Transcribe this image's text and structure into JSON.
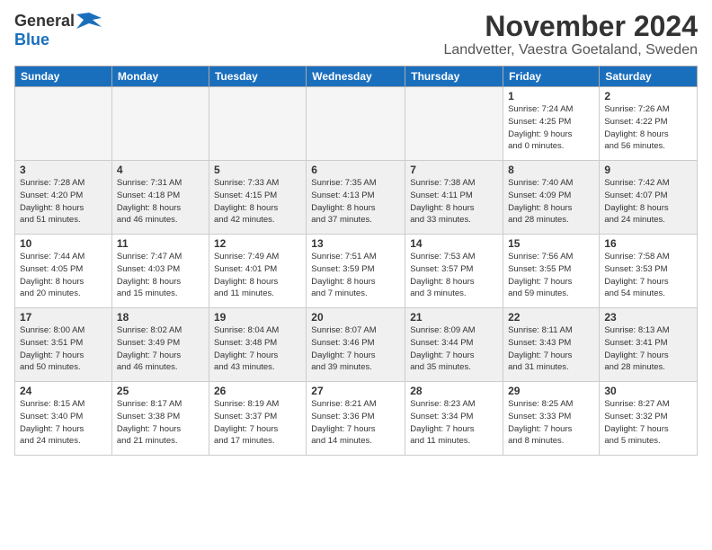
{
  "logo": {
    "general": "General",
    "blue": "Blue"
  },
  "title": "November 2024",
  "location": "Landvetter, Vaestra Goetaland, Sweden",
  "days_of_week": [
    "Sunday",
    "Monday",
    "Tuesday",
    "Wednesday",
    "Thursday",
    "Friday",
    "Saturday"
  ],
  "weeks": [
    {
      "shaded": false,
      "days": [
        {
          "num": "",
          "info": "",
          "empty": true
        },
        {
          "num": "",
          "info": "",
          "empty": true
        },
        {
          "num": "",
          "info": "",
          "empty": true
        },
        {
          "num": "",
          "info": "",
          "empty": true
        },
        {
          "num": "",
          "info": "",
          "empty": true
        },
        {
          "num": "1",
          "info": "Sunrise: 7:24 AM\nSunset: 4:25 PM\nDaylight: 9 hours\nand 0 minutes.",
          "empty": false
        },
        {
          "num": "2",
          "info": "Sunrise: 7:26 AM\nSunset: 4:22 PM\nDaylight: 8 hours\nand 56 minutes.",
          "empty": false
        }
      ]
    },
    {
      "shaded": true,
      "days": [
        {
          "num": "3",
          "info": "Sunrise: 7:28 AM\nSunset: 4:20 PM\nDaylight: 8 hours\nand 51 minutes.",
          "empty": false
        },
        {
          "num": "4",
          "info": "Sunrise: 7:31 AM\nSunset: 4:18 PM\nDaylight: 8 hours\nand 46 minutes.",
          "empty": false
        },
        {
          "num": "5",
          "info": "Sunrise: 7:33 AM\nSunset: 4:15 PM\nDaylight: 8 hours\nand 42 minutes.",
          "empty": false
        },
        {
          "num": "6",
          "info": "Sunrise: 7:35 AM\nSunset: 4:13 PM\nDaylight: 8 hours\nand 37 minutes.",
          "empty": false
        },
        {
          "num": "7",
          "info": "Sunrise: 7:38 AM\nSunset: 4:11 PM\nDaylight: 8 hours\nand 33 minutes.",
          "empty": false
        },
        {
          "num": "8",
          "info": "Sunrise: 7:40 AM\nSunset: 4:09 PM\nDaylight: 8 hours\nand 28 minutes.",
          "empty": false
        },
        {
          "num": "9",
          "info": "Sunrise: 7:42 AM\nSunset: 4:07 PM\nDaylight: 8 hours\nand 24 minutes.",
          "empty": false
        }
      ]
    },
    {
      "shaded": false,
      "days": [
        {
          "num": "10",
          "info": "Sunrise: 7:44 AM\nSunset: 4:05 PM\nDaylight: 8 hours\nand 20 minutes.",
          "empty": false
        },
        {
          "num": "11",
          "info": "Sunrise: 7:47 AM\nSunset: 4:03 PM\nDaylight: 8 hours\nand 15 minutes.",
          "empty": false
        },
        {
          "num": "12",
          "info": "Sunrise: 7:49 AM\nSunset: 4:01 PM\nDaylight: 8 hours\nand 11 minutes.",
          "empty": false
        },
        {
          "num": "13",
          "info": "Sunrise: 7:51 AM\nSunset: 3:59 PM\nDaylight: 8 hours\nand 7 minutes.",
          "empty": false
        },
        {
          "num": "14",
          "info": "Sunrise: 7:53 AM\nSunset: 3:57 PM\nDaylight: 8 hours\nand 3 minutes.",
          "empty": false
        },
        {
          "num": "15",
          "info": "Sunrise: 7:56 AM\nSunset: 3:55 PM\nDaylight: 7 hours\nand 59 minutes.",
          "empty": false
        },
        {
          "num": "16",
          "info": "Sunrise: 7:58 AM\nSunset: 3:53 PM\nDaylight: 7 hours\nand 54 minutes.",
          "empty": false
        }
      ]
    },
    {
      "shaded": true,
      "days": [
        {
          "num": "17",
          "info": "Sunrise: 8:00 AM\nSunset: 3:51 PM\nDaylight: 7 hours\nand 50 minutes.",
          "empty": false
        },
        {
          "num": "18",
          "info": "Sunrise: 8:02 AM\nSunset: 3:49 PM\nDaylight: 7 hours\nand 46 minutes.",
          "empty": false
        },
        {
          "num": "19",
          "info": "Sunrise: 8:04 AM\nSunset: 3:48 PM\nDaylight: 7 hours\nand 43 minutes.",
          "empty": false
        },
        {
          "num": "20",
          "info": "Sunrise: 8:07 AM\nSunset: 3:46 PM\nDaylight: 7 hours\nand 39 minutes.",
          "empty": false
        },
        {
          "num": "21",
          "info": "Sunrise: 8:09 AM\nSunset: 3:44 PM\nDaylight: 7 hours\nand 35 minutes.",
          "empty": false
        },
        {
          "num": "22",
          "info": "Sunrise: 8:11 AM\nSunset: 3:43 PM\nDaylight: 7 hours\nand 31 minutes.",
          "empty": false
        },
        {
          "num": "23",
          "info": "Sunrise: 8:13 AM\nSunset: 3:41 PM\nDaylight: 7 hours\nand 28 minutes.",
          "empty": false
        }
      ]
    },
    {
      "shaded": false,
      "days": [
        {
          "num": "24",
          "info": "Sunrise: 8:15 AM\nSunset: 3:40 PM\nDaylight: 7 hours\nand 24 minutes.",
          "empty": false
        },
        {
          "num": "25",
          "info": "Sunrise: 8:17 AM\nSunset: 3:38 PM\nDaylight: 7 hours\nand 21 minutes.",
          "empty": false
        },
        {
          "num": "26",
          "info": "Sunrise: 8:19 AM\nSunset: 3:37 PM\nDaylight: 7 hours\nand 17 minutes.",
          "empty": false
        },
        {
          "num": "27",
          "info": "Sunrise: 8:21 AM\nSunset: 3:36 PM\nDaylight: 7 hours\nand 14 minutes.",
          "empty": false
        },
        {
          "num": "28",
          "info": "Sunrise: 8:23 AM\nSunset: 3:34 PM\nDaylight: 7 hours\nand 11 minutes.",
          "empty": false
        },
        {
          "num": "29",
          "info": "Sunrise: 8:25 AM\nSunset: 3:33 PM\nDaylight: 7 hours\nand 8 minutes.",
          "empty": false
        },
        {
          "num": "30",
          "info": "Sunrise: 8:27 AM\nSunset: 3:32 PM\nDaylight: 7 hours\nand 5 minutes.",
          "empty": false
        }
      ]
    }
  ]
}
